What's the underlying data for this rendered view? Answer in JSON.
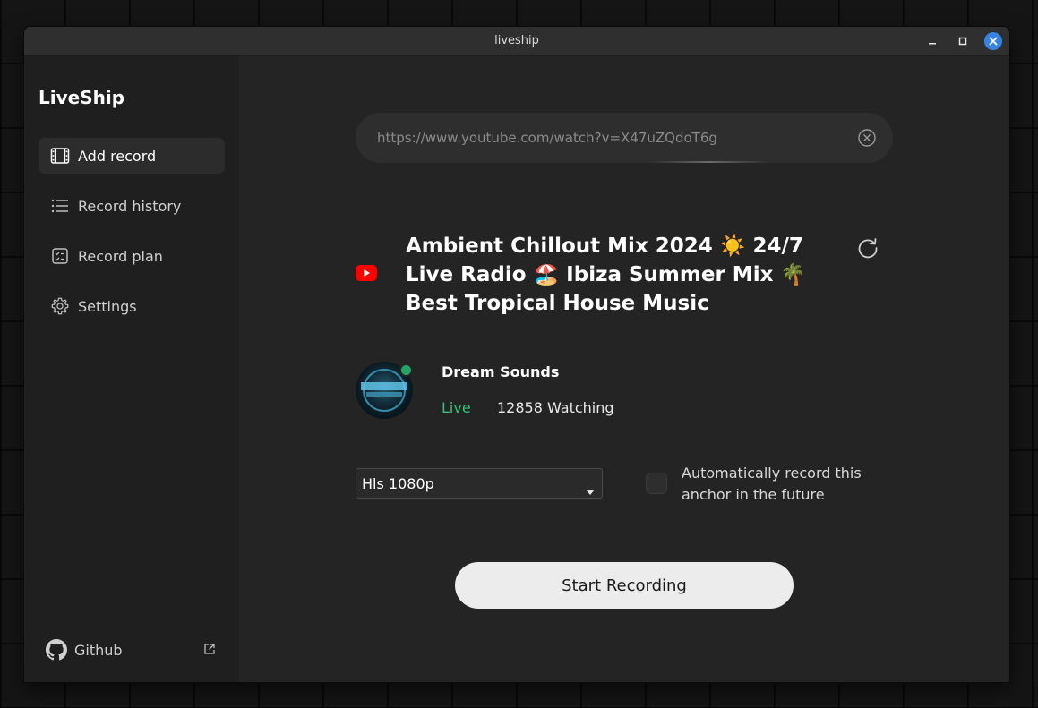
{
  "window": {
    "title": "liveship",
    "controls": [
      "minimize-icon",
      "maximize-icon",
      "close-icon"
    ]
  },
  "sidebar": {
    "brand": "LiveShip",
    "items": [
      {
        "label": "Add record",
        "icon": "film-icon",
        "active": true
      },
      {
        "label": "Record history",
        "icon": "list-icon",
        "active": false
      },
      {
        "label": "Record plan",
        "icon": "checklist-icon",
        "active": false
      },
      {
        "label": "Settings",
        "icon": "gear-icon",
        "active": false
      }
    ],
    "footer": {
      "label": "Github",
      "icon": "github-icon",
      "external_icon": "external-link-icon"
    }
  },
  "main": {
    "url": {
      "placeholder": "https://www.youtube.com/watch?v=X47uZQdoT6g",
      "value": "",
      "clear_icon": "clear-circle-icon"
    },
    "video": {
      "platform_icon": "youtube-icon",
      "title": "Ambient Chillout Mix 2024 ☀️ 24/7 Live Radio 🏖️ Ibiza Summer Mix 🌴 Best Tropical House Music",
      "refresh_icon": "refresh-icon"
    },
    "channel": {
      "name": "Dream Sounds",
      "status": "Live",
      "watching": "12858 Watching"
    },
    "quality": {
      "selected": "Hls 1080p"
    },
    "auto_record": {
      "label": "Automatically record this anchor in the future",
      "checked": false
    },
    "start_button": "Start Recording"
  },
  "colors": {
    "accent_blue": "#3584e4",
    "live_green": "#33c27a",
    "youtube_red": "#ff0000",
    "window_bg": "#242424",
    "sidebar_bg": "#1f1f1f"
  }
}
